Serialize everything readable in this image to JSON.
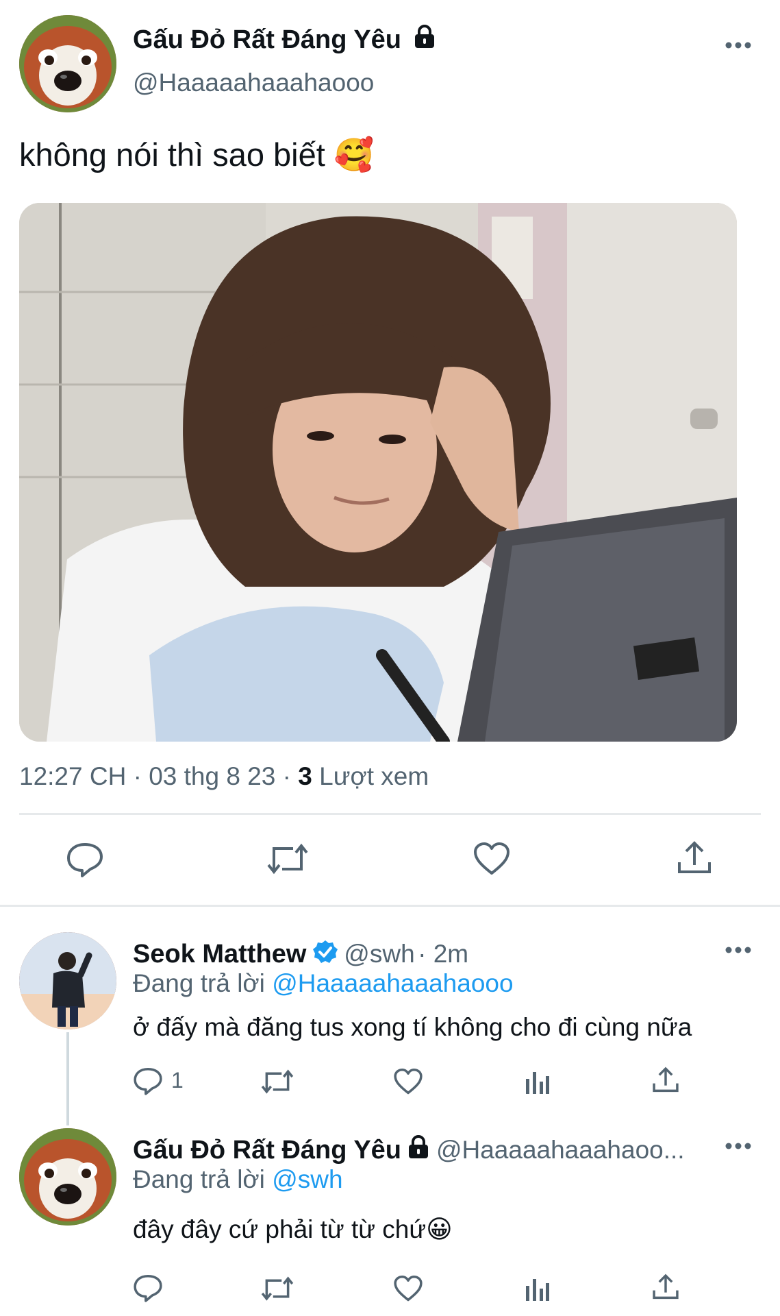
{
  "tweet": {
    "author_name": "Gấu Đỏ Rất Đáng Yêu",
    "author_handle": "@Haaaaahaaahaooo",
    "text": "không nói thì sao biết",
    "emoji": "🥰",
    "time": "12:27 CH",
    "date": "03 thg 8 23",
    "views_count": "3",
    "views_label": "Lượt xem",
    "sep": "·"
  },
  "reply1": {
    "author_name": "Seok Matthew",
    "author_handle": "@swh",
    "time": "· 2m",
    "replying_prefix": "Đang trả lời",
    "replying_to": "@Haaaaahaaahaooo",
    "text": "ở đấy mà đăng tus xong tí không cho đi cùng nữa",
    "reply_count": "1"
  },
  "reply2": {
    "author_name": "Gấu Đỏ Rất Đáng Yêu",
    "author_handle": "@Haaaaahaaahaoo...",
    "replying_prefix": "Đang trả lời",
    "replying_to": "@swh",
    "text": "đây đây cứ phải từ từ chứ",
    "emoji": "😀"
  },
  "icons": {
    "more": "more-icon",
    "lock": "lock-icon",
    "verified": "verified-badge-icon",
    "reply": "reply-icon",
    "retweet": "retweet-icon",
    "like": "like-icon",
    "share": "share-icon",
    "analytics": "analytics-icon"
  },
  "colors": {
    "text": "#0f1419",
    "muted": "#536471",
    "link": "#1d9bf0",
    "divider": "#e6e9eb"
  }
}
